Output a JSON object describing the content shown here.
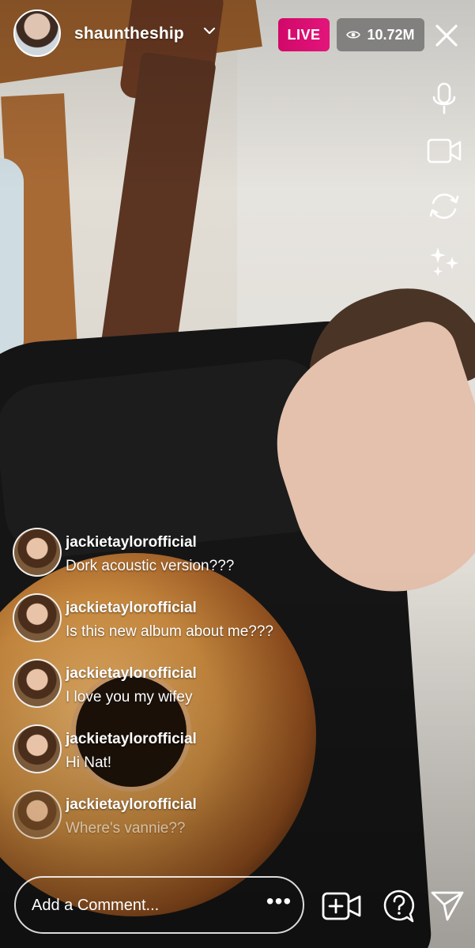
{
  "host": {
    "username": "shauntheship"
  },
  "status": {
    "live_label": "LIVE",
    "viewer_count": "10.72M"
  },
  "icons": {
    "close": "close-icon",
    "microphone": "microphone-icon",
    "camera": "video-camera-icon",
    "flip": "flip-camera-icon",
    "effects": "sparkles-icon",
    "more": "more-dots-icon",
    "add_guest": "add-video-icon",
    "question": "question-bubble-icon",
    "share": "send-icon"
  },
  "comments": [
    {
      "username": "jackietaylorofficial",
      "text": "Dork acoustic version???"
    },
    {
      "username": "jackietaylorofficial",
      "text": "Is this new album about me???"
    },
    {
      "username": "jackietaylorofficial",
      "text": "I love you my wifey"
    },
    {
      "username": "jackietaylorofficial",
      "text": "Hi Nat!"
    },
    {
      "username": "jackietaylorofficial",
      "text": "Where's vannie??"
    }
  ],
  "composer": {
    "placeholder": "Add a Comment...",
    "more_label": "•••"
  },
  "colors": {
    "live": "#d10869",
    "viewer_badge": "#646464",
    "text": "#ffffff"
  }
}
